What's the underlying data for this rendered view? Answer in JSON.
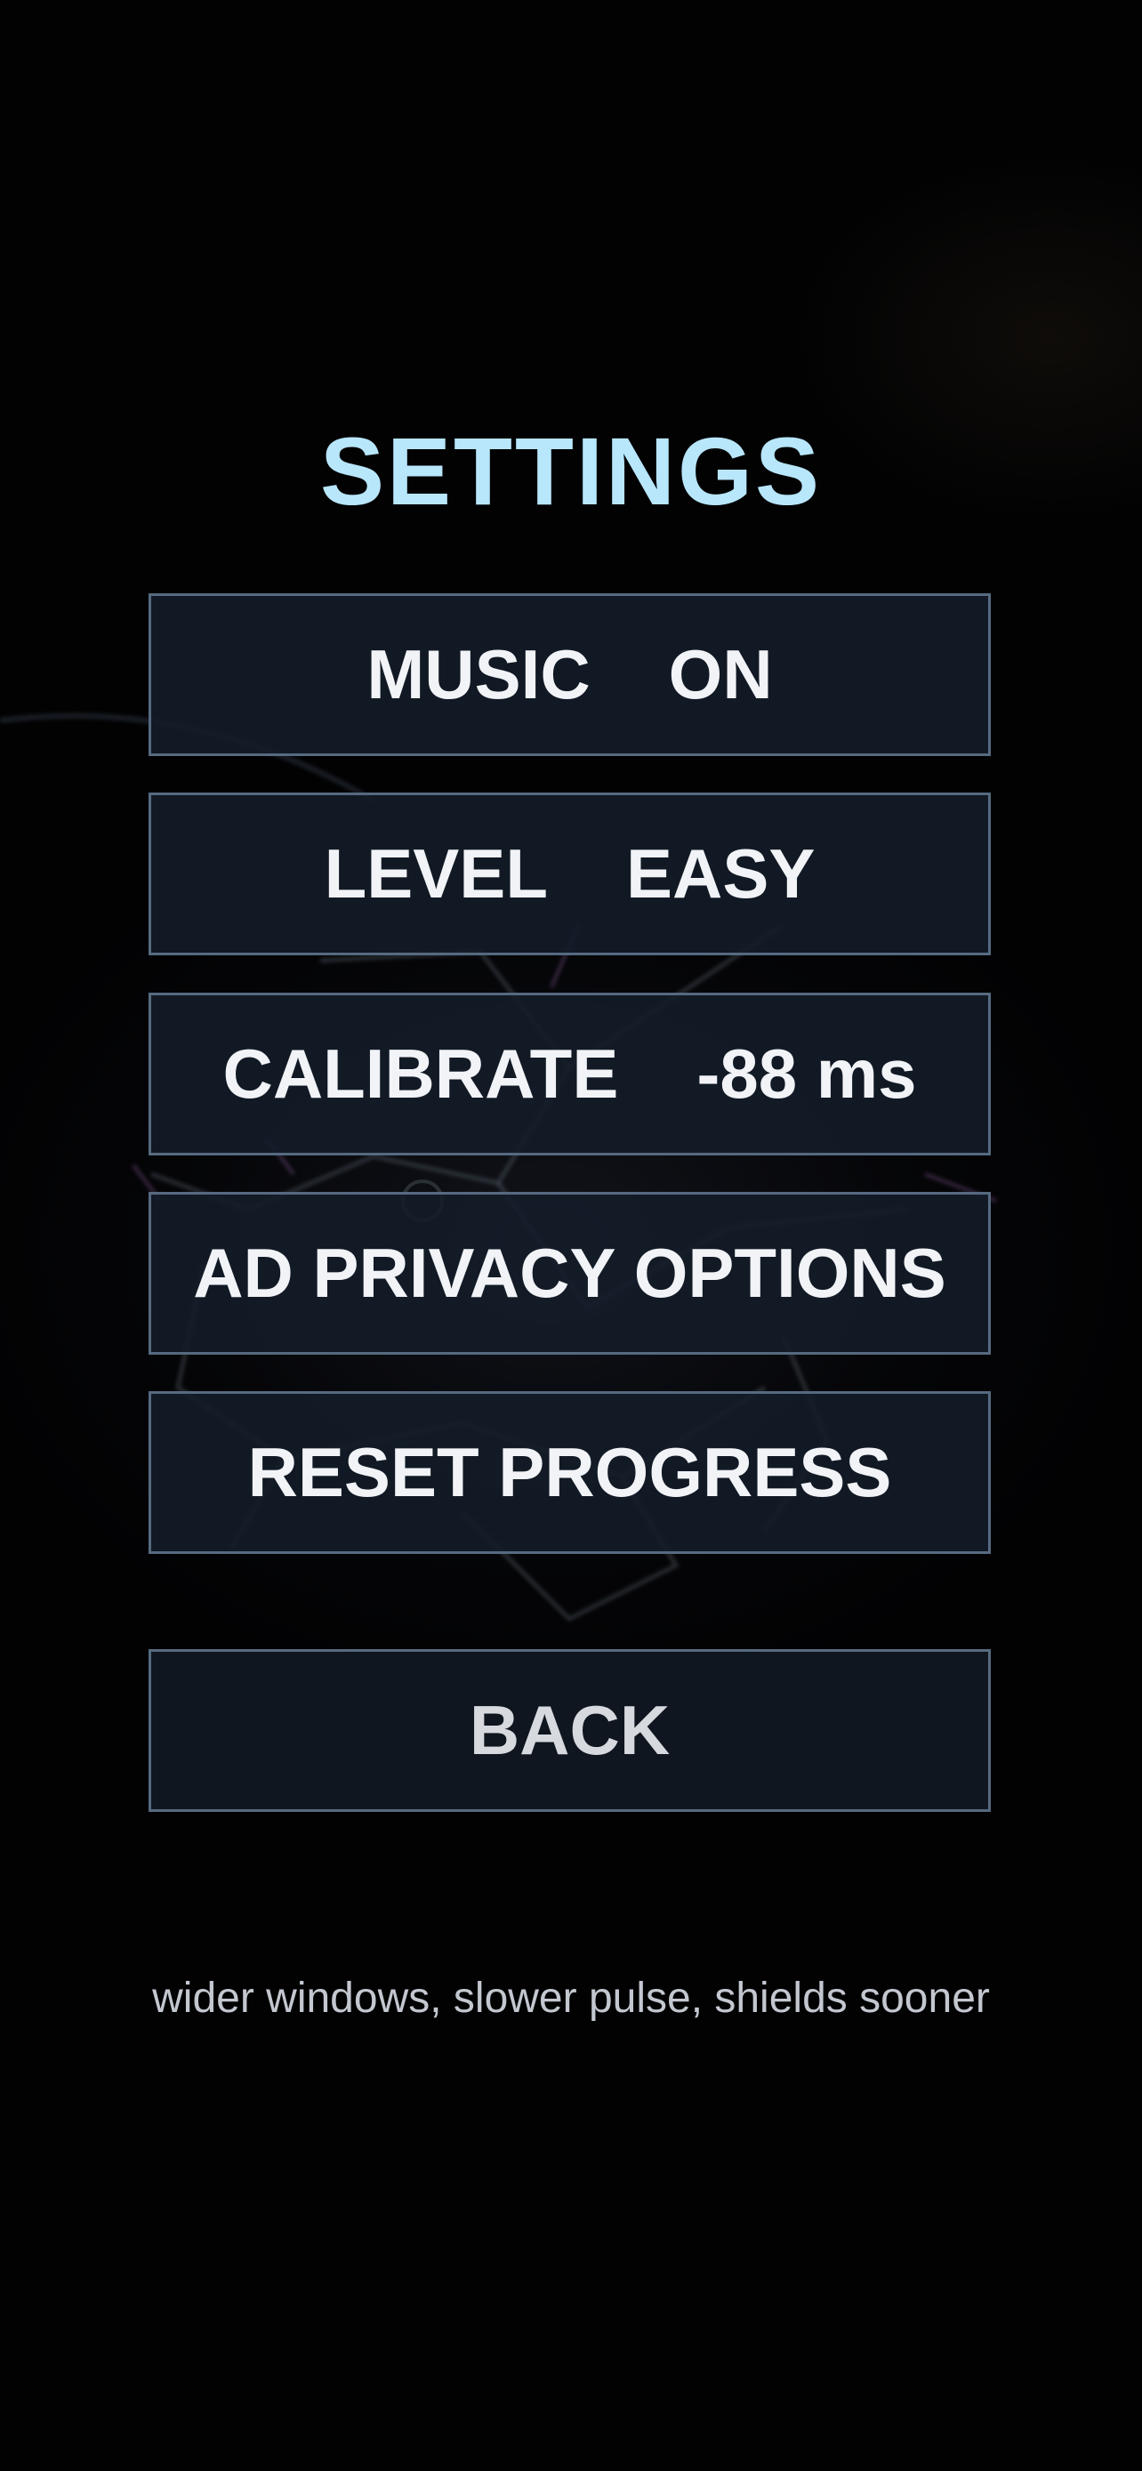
{
  "settings": {
    "title": "SETTINGS",
    "music": {
      "label": "MUSIC",
      "value": "ON"
    },
    "level": {
      "label": "LEVEL",
      "value": "EASY"
    },
    "calibrate": {
      "label": "CALIBRATE",
      "value": "-88 ms"
    },
    "ad_privacy_label": "AD PRIVACY OPTIONS",
    "reset_label": "RESET PROGRESS",
    "back_label": "BACK",
    "level_hint": "wider windows, slower pulse, shields sooner"
  },
  "colors": {
    "title": "#b8e6fb",
    "button_border": "#566a80",
    "button_fill": "#131d29",
    "button_text": "#f1f3f6",
    "background": "#020203"
  }
}
